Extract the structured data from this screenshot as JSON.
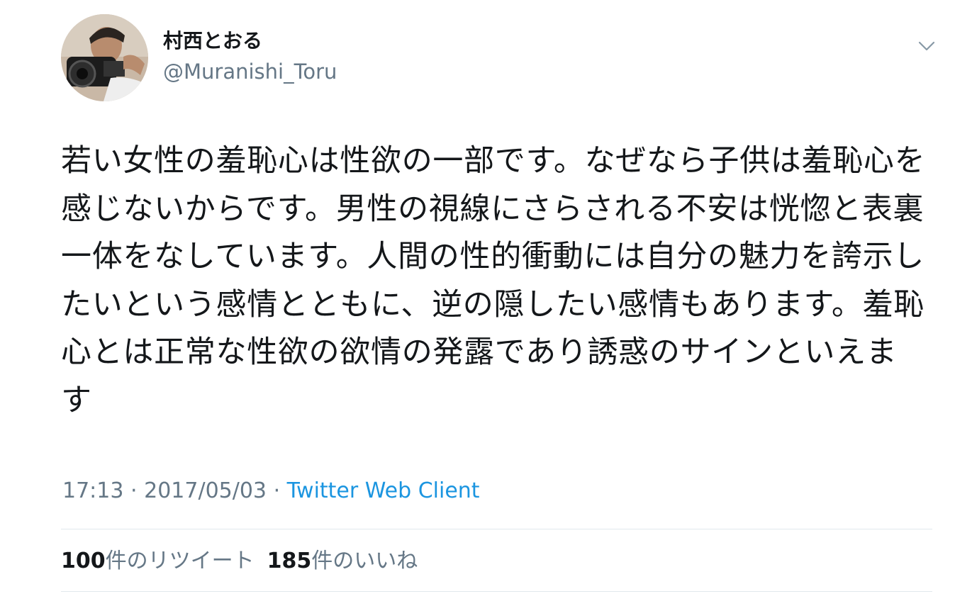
{
  "user": {
    "display_name": "村西とおる",
    "handle": "@Muranishi_Toru",
    "avatar_icon": "profile-photo"
  },
  "tweet": {
    "text": "若い女性の羞恥心は性欲の一部です。なぜなら子供は羞恥心を感じないからです。男性の視線にさらされる不安は恍惚と表裏一体をなしています。人間の性的衝動には自分の魅力を誇示したいという感情とともに、逆の隠したい感情もあります。羞恥心とは正常な性欲の欲情の発露であり誘惑のサインといえます",
    "time": "17:13",
    "separator": "·",
    "date": "2017/05/03",
    "source": "Twitter Web Client"
  },
  "stats": {
    "retweets_count": "100",
    "retweets_label": "件のリツイート",
    "likes_count": "185",
    "likes_label": "件のいいね"
  },
  "icons": {
    "menu": "chevron-down-icon"
  },
  "colors": {
    "text": "#14171a",
    "secondary": "#657786",
    "link": "#1b95e0",
    "divider": "#e1e8ed"
  }
}
